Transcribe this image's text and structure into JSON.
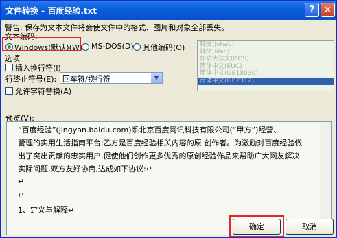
{
  "window": {
    "title": "文件转换 - 百度经验.txt",
    "help_label": "?",
    "close_label": "×"
  },
  "warning": "警告: 保存为文本文件将会使文件中的格式、图片和对象全部丢失。",
  "encoding": {
    "group_label": "文本编码:",
    "options": [
      {
        "label": "Windows(默认)(W)",
        "selected": true
      },
      {
        "label": "MS-DOS(D)",
        "selected": false
      },
      {
        "label": "其他编码(O)",
        "selected": false
      }
    ],
    "list": [
      "韩文(Johab)",
      "韩文(Mac)",
      "加拿大法文(DOS)",
      "简体中文(EUC)",
      "简体中文(GB18030)",
      "简体中文(GB2312)"
    ]
  },
  "options": {
    "group_label": "选项",
    "insert_line_breaks": "插入换行符(I)",
    "line_end_label": "行终止符号(E):",
    "line_end_value": "回车符/换行符",
    "allow_substitution": "允许字符替换(A)"
  },
  "preview": {
    "label": "预览(V):",
    "lines": [
      "“百度经验”(jingyan.baidu.com)系北京百度网讯科技有限公司(“甲方”)经营、",
      "管理的实用生活指南平台;乙方是百度经验相关内容的原 创作者。为激励对百度经验做",
      "出了突出贡献的忠实用户,促使他们创作更多优秀的原创经验作品来帮助广大网友解决",
      "实际问题,双方友好协商,达成如下协议:↵",
      "↵",
      "↵",
      "1、定义与解释↵"
    ]
  },
  "buttons": {
    "ok": "确定",
    "cancel": "取消"
  }
}
